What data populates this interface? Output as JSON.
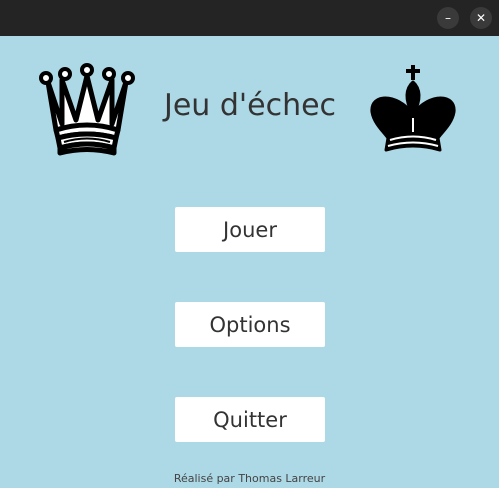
{
  "window": {
    "minimize_glyph": "–",
    "close_glyph": "✕"
  },
  "header": {
    "title": "Jeu d'échec",
    "left_icon": "white-queen-icon",
    "right_icon": "black-king-icon"
  },
  "menu": {
    "play_label": "Jouer",
    "options_label": "Options",
    "quit_label": "Quitter"
  },
  "footer": {
    "credit": "Réalisé par Thomas Larreur"
  },
  "colors": {
    "background": "#add8e6",
    "titlebar": "#242424",
    "button": "#ffffff",
    "text": "#333333"
  }
}
